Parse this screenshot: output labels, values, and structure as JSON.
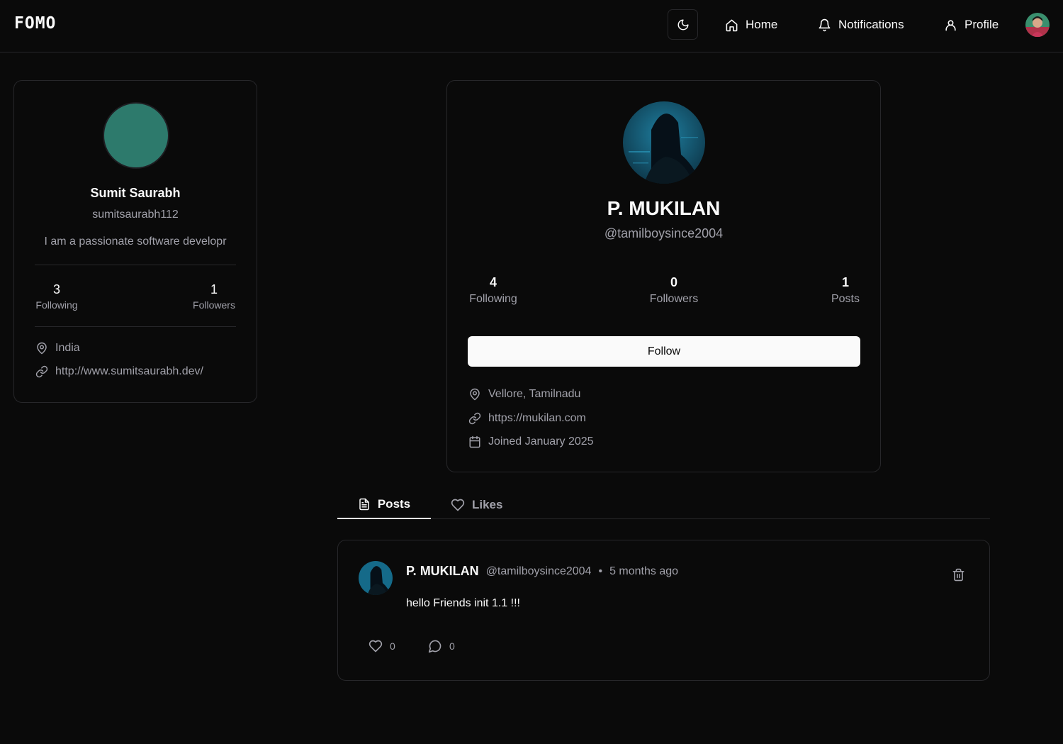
{
  "navbar": {
    "logo": "FOMO",
    "links": [
      {
        "label": "Home",
        "icon": "home-icon"
      },
      {
        "label": "Notifications",
        "icon": "bell-icon"
      },
      {
        "label": "Profile",
        "icon": "user-icon"
      }
    ],
    "theme_toggle_icon": "moon-icon"
  },
  "sidebar_profile": {
    "name": "Sumit Saurabh",
    "username": "sumitsaurabh112",
    "bio": "I am a passionate software developr",
    "following_count": "3",
    "following_label": "Following",
    "followers_count": "1",
    "followers_label": "Followers",
    "location": "India",
    "website": "http://www.sumitsaurabh.dev/",
    "avatar_color": "#2d7a6c"
  },
  "profile": {
    "name": "P. MUKILAN",
    "handle": "@tamilboysince2004",
    "stats": [
      {
        "count": "4",
        "label": "Following"
      },
      {
        "count": "0",
        "label": "Followers"
      },
      {
        "count": "1",
        "label": "Posts"
      }
    ],
    "follow_label": "Follow",
    "location": "Vellore, Tamilnadu",
    "website": "https://mukilan.com",
    "joined": "Joined January 2025"
  },
  "tabs": [
    {
      "label": "Posts",
      "icon": "file-text-icon",
      "active": true
    },
    {
      "label": "Likes",
      "icon": "heart-icon",
      "active": false
    }
  ],
  "posts": [
    {
      "author": "P. MUKILAN",
      "handle": "@tamilboysince2004",
      "separator": "•",
      "time": "5 months ago",
      "content": "hello Friends init 1.1 !!!",
      "likes": "0",
      "comments": "0"
    }
  ],
  "colors": {
    "background": "#0a0a0a",
    "border": "#27272a",
    "text": "#fafafa",
    "muted": "#a1a1aa",
    "button_bg": "#fafafa"
  }
}
